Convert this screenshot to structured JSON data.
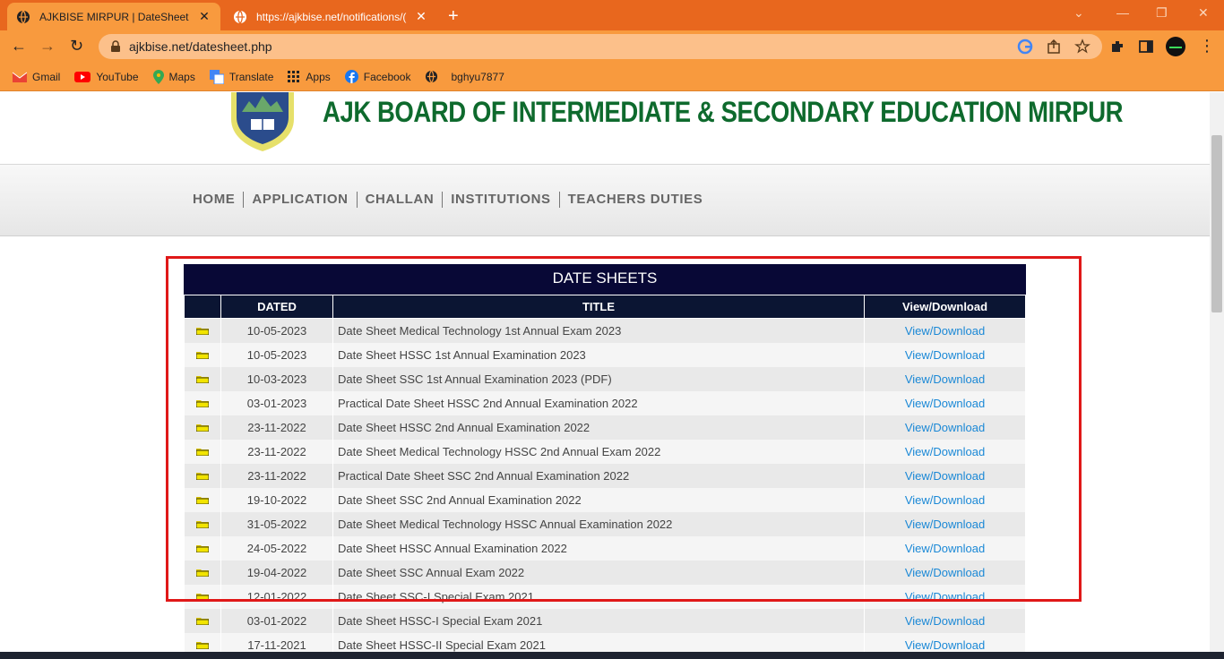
{
  "browser": {
    "tabs": [
      {
        "title": "AJKBISE MIRPUR | DateSheet",
        "active": true
      },
      {
        "title": "https://ajkbise.net/notifications/(",
        "active": false
      }
    ],
    "url": "ajkbise.net/datesheet.php",
    "bookmarks": [
      "Gmail",
      "YouTube",
      "Maps",
      "Translate",
      "Apps",
      "Facebook",
      "bghyu7877"
    ]
  },
  "site": {
    "title": "AJK BOARD OF INTERMEDIATE & SECONDARY EDUCATION MIRPUR",
    "menu": [
      "HOME",
      "APPLICATION",
      "CHALLAN",
      "INSTITUTIONS",
      "TEACHERS DUTIES"
    ]
  },
  "datesheets": {
    "heading": "DATE SHEETS",
    "columns": [
      "DATED",
      "TITLE",
      "View/Download"
    ],
    "link_label": "View/Download",
    "rows": [
      {
        "date": "10-05-2023",
        "title": "Date Sheet Medical Technology 1st Annual Exam 2023"
      },
      {
        "date": "10-05-2023",
        "title": "Date Sheet HSSC 1st Annual Examination 2023"
      },
      {
        "date": "10-03-2023",
        "title": "Date Sheet SSC 1st Annual Examination 2023 (PDF)"
      },
      {
        "date": "03-01-2023",
        "title": "Practical Date Sheet HSSC 2nd Annual Examination 2022"
      },
      {
        "date": "23-11-2022",
        "title": "Date Sheet HSSC 2nd Annual Examination 2022"
      },
      {
        "date": "23-11-2022",
        "title": "Date Sheet Medical Technology HSSC 2nd Annual Exam 2022"
      },
      {
        "date": "23-11-2022",
        "title": "Practical Date Sheet SSC 2nd Annual Examination 2022"
      },
      {
        "date": "19-10-2022",
        "title": "Date Sheet SSC 2nd Annual Examination 2022"
      },
      {
        "date": "31-05-2022",
        "title": "Date Sheet Medical Technology HSSC Annual Examination 2022"
      },
      {
        "date": "24-05-2022",
        "title": "Date Sheet HSSC Annual Examination 2022"
      },
      {
        "date": "19-04-2022",
        "title": "Date Sheet SSC Annual Exam 2022"
      },
      {
        "date": "12-01-2022",
        "title": "Date Sheet SSC-I Special Exam 2021"
      },
      {
        "date": "03-01-2022",
        "title": "Date Sheet HSSC-I Special Exam 2021"
      },
      {
        "date": "17-11-2021",
        "title": "Date Sheet HSSC-II Special Exam 2021"
      }
    ]
  },
  "colors": {
    "chrome_orange": "#e8671e",
    "toolbar_orange": "#f89a3e",
    "title_green": "#0e6a2d",
    "table_header_navy": "#080836",
    "link_blue": "#1a88d6",
    "highlight_red": "#e01818"
  }
}
